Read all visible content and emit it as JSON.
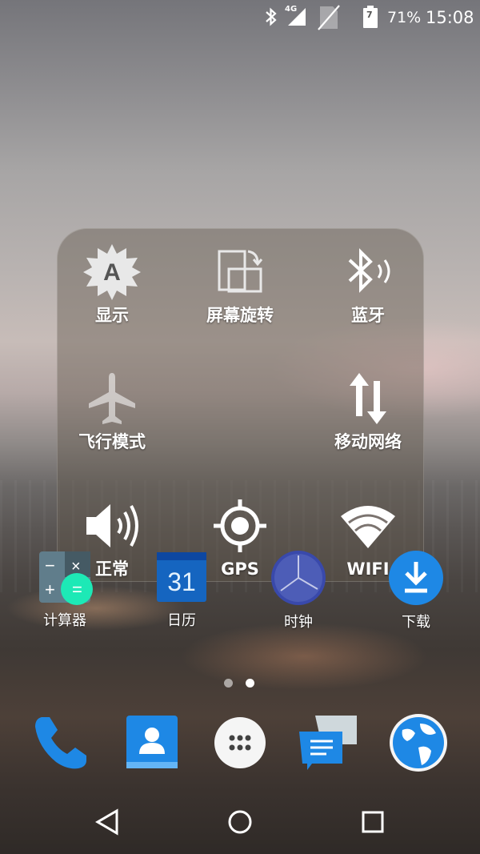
{
  "status_bar": {
    "network_type": "4G",
    "sim_badge": "7",
    "battery_percent": "71%",
    "time": "15:08",
    "icons": [
      "bluetooth-icon",
      "signal-icon",
      "no-sim-icon",
      "battery-icon"
    ]
  },
  "quick_panel": {
    "tiles": [
      {
        "label": "显示",
        "icon": "auto-brightness-icon",
        "badge": "A"
      },
      {
        "label": "屏幕旋转",
        "icon": "screen-rotate-icon"
      },
      {
        "label": "蓝牙",
        "icon": "bluetooth-icon"
      },
      {
        "label": "飞行模式",
        "icon": "airplane-icon"
      },
      {
        "label": "移动网络",
        "icon": "mobile-data-icon"
      },
      {
        "label": "正常",
        "icon": "volume-icon"
      },
      {
        "label": "GPS",
        "icon": "gps-icon"
      },
      {
        "label": "WIFI",
        "icon": "wifi-icon"
      }
    ]
  },
  "home_apps": [
    {
      "label": "计算器",
      "icon": "calculator-icon"
    },
    {
      "label": "日历",
      "icon": "calendar-icon",
      "badge": "31"
    },
    {
      "label": "时钟",
      "icon": "clock-icon"
    },
    {
      "label": "下载",
      "icon": "download-icon"
    }
  ],
  "page_indicator": {
    "pages": 2,
    "current": 2
  },
  "dock": [
    "phone-icon",
    "contacts-icon",
    "app-drawer-icon",
    "messages-icon",
    "browser-icon"
  ],
  "nav_bar": [
    "back-icon",
    "home-icon",
    "recents-icon"
  ],
  "colors": {
    "accent_blue": "#1e88e5",
    "calculator_green": "#1de9b6",
    "calendar_blue": "#1565c0"
  }
}
